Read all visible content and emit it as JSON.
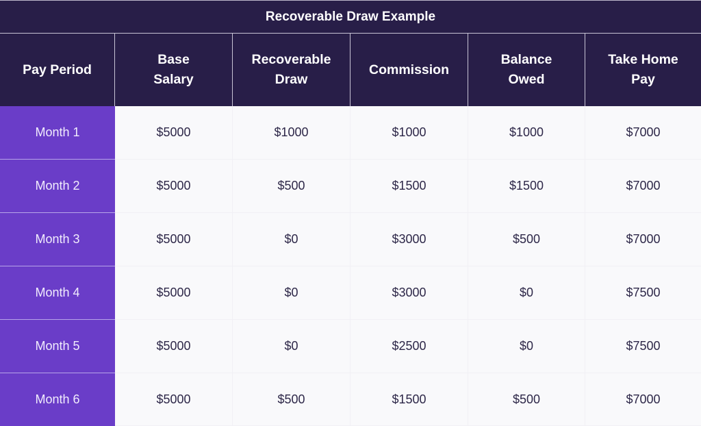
{
  "title": "Recoverable Draw Example",
  "colors": {
    "header_bg": "#281e48",
    "period_bg": "#6a3dc8",
    "body_bg": "#f9f9fb",
    "body_text": "#2d2748"
  },
  "columns": [
    "Pay Period",
    "Base\nSalary",
    "Recoverable\nDraw",
    "Commission",
    "Balance\nOwed",
    "Take Home\nPay"
  ],
  "rows": [
    {
      "period": "Month 1",
      "base_salary": "$5000",
      "recoverable_draw": "$1000",
      "commission": "$1000",
      "balance_owed": "$1000",
      "take_home_pay": "$7000"
    },
    {
      "period": "Month 2",
      "base_salary": "$5000",
      "recoverable_draw": "$500",
      "commission": "$1500",
      "balance_owed": "$1500",
      "take_home_pay": "$7000"
    },
    {
      "period": "Month 3",
      "base_salary": "$5000",
      "recoverable_draw": "$0",
      "commission": "$3000",
      "balance_owed": "$500",
      "take_home_pay": "$7000"
    },
    {
      "period": "Month 4",
      "base_salary": "$5000",
      "recoverable_draw": "$0",
      "commission": "$3000",
      "balance_owed": "$0",
      "take_home_pay": "$7500"
    },
    {
      "period": "Month 5",
      "base_salary": "$5000",
      "recoverable_draw": "$0",
      "commission": "$2500",
      "balance_owed": "$0",
      "take_home_pay": "$7500"
    },
    {
      "period": "Month 6",
      "base_salary": "$5000",
      "recoverable_draw": "$500",
      "commission": "$1500",
      "balance_owed": "$500",
      "take_home_pay": "$7000"
    }
  ]
}
